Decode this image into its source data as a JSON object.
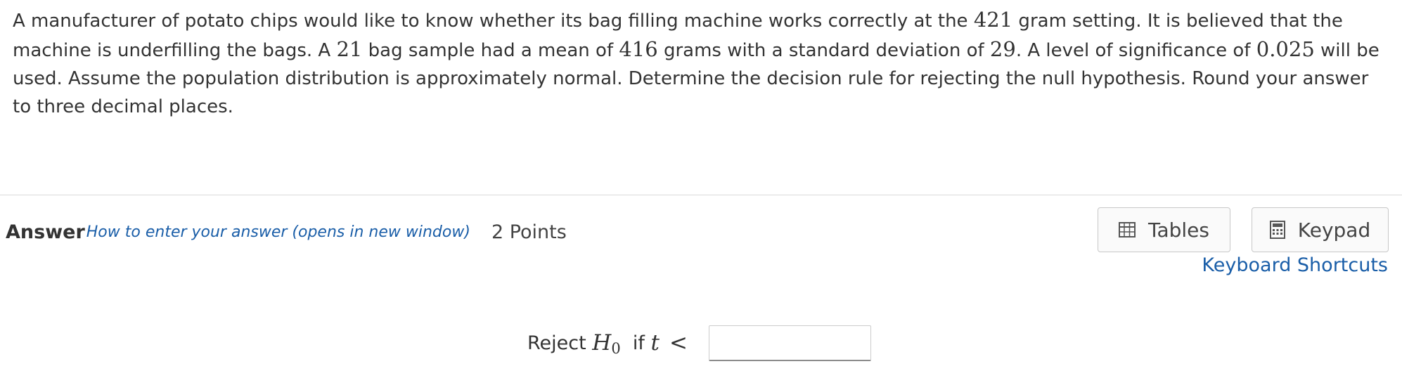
{
  "question": {
    "p1": "A manufacturer of potato chips would like to know whether its bag filling machine works correctly at the ",
    "setting": "421",
    "p2": " gram setting. It is believed that the machine is underfilling the bags. A ",
    "sample_size": "21",
    "p3": " bag sample had a mean of ",
    "mean": "416",
    "p4": " grams with a standard deviation of ",
    "std_dev": "29",
    "p5": ". A level of significance of ",
    "alpha": "0.025",
    "p6": " will be used. Assume the population distribution is approximately normal. Determine the decision rule for rejecting the null hypothesis. Round your answer to three decimal places."
  },
  "answer": {
    "label": "Answer",
    "how_to_link": "How to enter your answer (opens in new window)",
    "points": "2 Points"
  },
  "tools": {
    "tables_label": "Tables",
    "keypad_label": "Keypad",
    "shortcuts_link": "Keyboard Shortcuts",
    "tables_icon": "table-icon",
    "keypad_icon": "calculator-icon"
  },
  "decision_rule": {
    "prefix": "Reject",
    "hypothesis_var": "H",
    "hypothesis_sub": "0",
    "if_text": "if",
    "stat_var": "t",
    "operator": "<",
    "input_value": "",
    "input_placeholder": ""
  },
  "colors": {
    "link": "#1a5ea8",
    "text": "#333333",
    "border": "#c8c8c8"
  }
}
